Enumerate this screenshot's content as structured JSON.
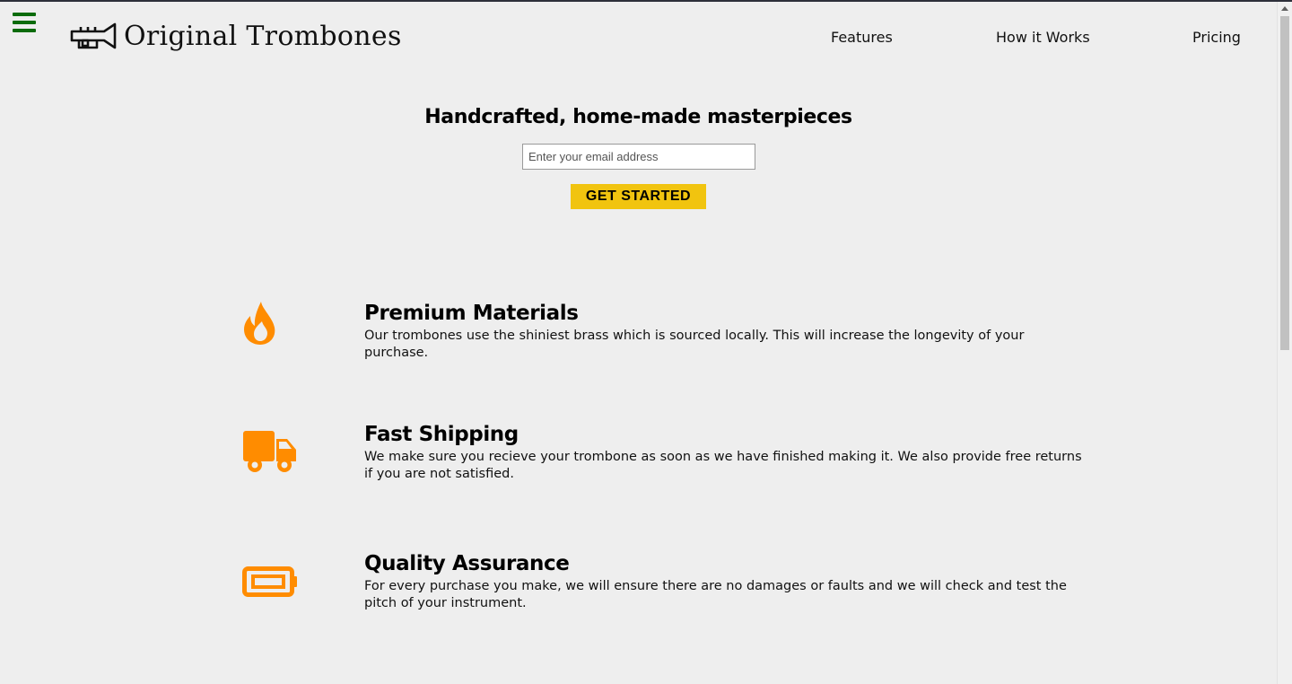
{
  "header": {
    "brand_title": "Original Trombones",
    "menu_icon": "hamburger-menu-icon",
    "logo_icon": "trumpet-logo-icon",
    "nav": [
      {
        "label": "Features"
      },
      {
        "label": "How it Works"
      },
      {
        "label": "Pricing"
      }
    ]
  },
  "hero": {
    "title": "Handcrafted, home-made masterpieces",
    "email_placeholder": "Enter your email address",
    "email_value": "",
    "cta_label": "GET STARTED"
  },
  "features": [
    {
      "icon": "fire-icon",
      "title": "Premium Materials",
      "text": "Our trombones use the shiniest brass which is sourced locally. This will increase the longevity of your purchase."
    },
    {
      "icon": "truck-icon",
      "title": "Fast Shipping",
      "text": "We make sure you recieve your trombone as soon as we have finished making it. We also provide free returns if you are not satisfied."
    },
    {
      "icon": "battery-icon",
      "title": "Quality Assurance",
      "text": "For every purchase you make, we will ensure there are no damages or faults and we will check and test the pitch of your instrument."
    }
  ],
  "colors": {
    "background": "#eeeeee",
    "accent_icon": "#ff8c00",
    "cta_background": "#f1c40f",
    "menu_icon": "#0b6b0b"
  }
}
